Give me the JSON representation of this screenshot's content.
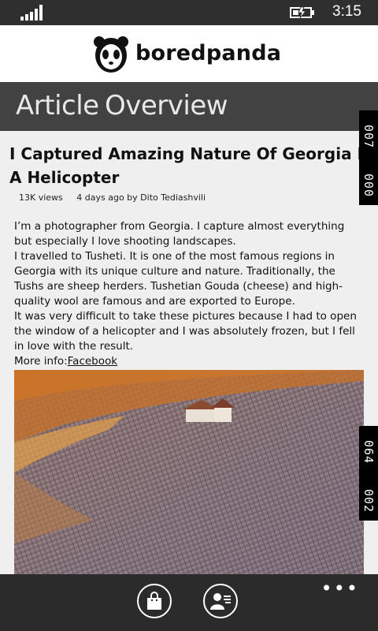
{
  "status_bar": {
    "time": "3:15"
  },
  "header": {
    "brand": "boredpanda"
  },
  "pivot": {
    "items": [
      "Article",
      "Overview"
    ]
  },
  "article": {
    "title_line1": "I Captured Amazing Nature Of Georgia From",
    "title_line2": "A Helicopter",
    "views": "13K views",
    "date_author": "4 days ago by Dito Tediashvili",
    "paragraphs": [
      "I’m a photographer from Georgia. I capture almost everything but especially I love shooting landscapes.",
      "I travelled to Tusheti. It is one of the most famous regions in Georgia with its unique culture and nature. Traditionally, the Tushs are sheep herders. Tushetian Gouda (cheese) and high-quality wool are famous and are exported to Europe.",
      "It was very difficult to take these pictures because I had to open the window of a helicopter and I was absolutely frozen, but I fell in love with the result."
    ],
    "more_info_label": "More info:",
    "more_info_link": "Facebook"
  },
  "side_tags": {
    "top": [
      "007",
      "000"
    ],
    "mid": [
      "064",
      "002"
    ]
  },
  "app_bar": {
    "more": "•••"
  },
  "colors": {
    "status_bar": "#2f2f2f",
    "pivot_bg": "#424242",
    "app_bar": "#2b2b2b"
  }
}
